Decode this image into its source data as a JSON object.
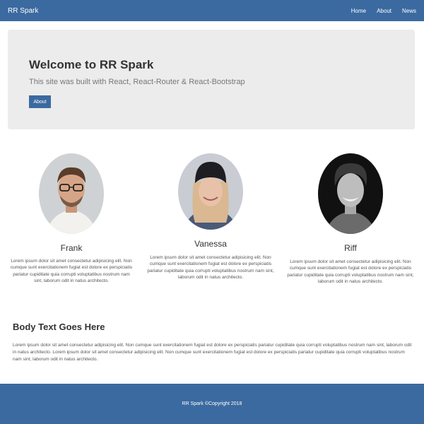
{
  "navbar": {
    "brand": "RR Spark",
    "links": [
      "Home",
      "About",
      "News"
    ]
  },
  "jumbotron": {
    "title": "Welcome to RR Spark",
    "subtitle": "This site was built with React, React-Router & React-Bootstrap",
    "button_label": "About"
  },
  "profiles": [
    {
      "name": "Frank",
      "description": "Lorem ipsum dolor sit amet consectetur adipisicing elit. Non cumque sunt exercitationem fugiat est dolore ex perspiciatis pariatur cupiditate quia corrupti voluptatibus nostrum nam sint, laborum odit in natus architecto."
    },
    {
      "name": "Vanessa",
      "description": "Lorem ipsum dolor sit amet consectetur adipisicing elit. Non cumque sunt exercitationem fugiat est dolore ex perspiciatis pariatur cupiditate quia corrupti voluptatibus nostrum nam sint, laborum odit in natus architecto."
    },
    {
      "name": "Riff",
      "description": "Lorem ipsum dolor sit amet consectetur adipisicing elit. Non cumque sunt exercitationem fugiat est dolore ex perspiciatis pariatur cupiditate quia corrupti voluptatibus nostrum nam sint, laborum odit in natus architecto."
    }
  ],
  "body": {
    "title": "Body Text Goes Here",
    "text": "Lorem ipsum dolor sit amet consectetur adipisicing elit. Non cumque sunt exercitationem fugiat est dolore ex perspiciatis pariatur cupiditate quia corrupti voluptatibus nostrum nam sint, laborum odit in natus architecto. Lorem ipsum dolor sit amet consectetur adipisicing elit. Non cumque sunt exercitationem fugiat est dolore ex perspiciatis pariatur cupiditate quia corrupti voluptatibus nostrum nam sint, laborum odit in natus architecto."
  },
  "footer": {
    "text": "RR Spark ©Copyright 2018"
  },
  "colors": {
    "primary": "#3b6aa0",
    "jumbotron_bg": "#ececec"
  }
}
